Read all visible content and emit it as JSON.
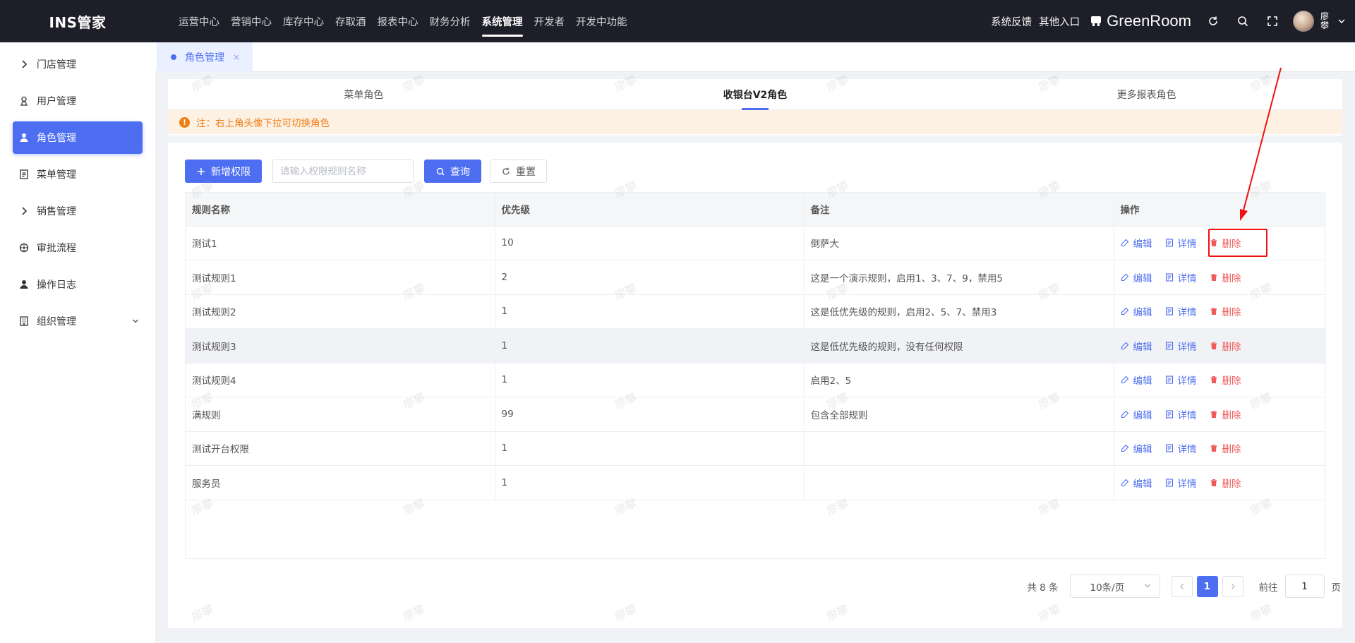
{
  "app": {
    "logo": "INS管家"
  },
  "topnav": [
    {
      "label": "运营中心",
      "active": false
    },
    {
      "label": "营销中心",
      "active": false
    },
    {
      "label": "库存中心",
      "active": false
    },
    {
      "label": "存取酒",
      "active": false
    },
    {
      "label": "报表中心",
      "active": false
    },
    {
      "label": "财务分析",
      "active": false
    },
    {
      "label": "系统管理",
      "active": true
    },
    {
      "label": "开发者",
      "active": false
    },
    {
      "label": "开发中功能",
      "active": false
    }
  ],
  "topright": {
    "feedback": "系统反馈",
    "other_entry": "其他入口",
    "store_icon": "store-icon",
    "store_name": "GreenRoom",
    "refresh_icon": "refresh-icon",
    "search_icon": "search-icon",
    "fullscreen_icon": "fullscreen-icon",
    "user_name": "廖攀",
    "caret_icon": "chevron-down-icon"
  },
  "sidebar": {
    "items": [
      {
        "label": "门店管理",
        "icon": "chevron-right-icon",
        "active": false
      },
      {
        "label": "用户管理",
        "icon": "user-icon",
        "active": false
      },
      {
        "label": "角色管理",
        "icon": "person-icon",
        "active": true
      },
      {
        "label": "菜单管理",
        "icon": "document-icon",
        "active": false
      },
      {
        "label": "销售管理",
        "icon": "chevron-right-icon",
        "active": false
      },
      {
        "label": "审批流程",
        "icon": "flow-icon",
        "active": false
      },
      {
        "label": "操作日志",
        "icon": "person-icon",
        "active": false
      },
      {
        "label": "组织管理",
        "icon": "building-icon",
        "active": false,
        "expandable": true
      }
    ]
  },
  "page_tabs": [
    {
      "label": "角色管理",
      "close": "×"
    }
  ],
  "role_tabs": [
    {
      "label": "菜单角色",
      "active": false
    },
    {
      "label": "收银台V2角色",
      "active": true
    },
    {
      "label": "更多报表角色",
      "active": false
    }
  ],
  "notice": {
    "icon": "warning-icon",
    "text": "注：右上角头像下拉可切换角色"
  },
  "toolbar": {
    "add_label": "新增权限",
    "search_placeholder": "请输入权限规则名称",
    "search_value": "",
    "query_label": "查询",
    "reset_label": "重置"
  },
  "table": {
    "headers": [
      "规则名称",
      "优先级",
      "备注",
      "操作"
    ],
    "actions": {
      "edit": "编辑",
      "detail": "详情",
      "delete": "删除"
    },
    "rows": [
      {
        "name": "测试1",
        "priority": "10",
        "note": "倒萨大"
      },
      {
        "name": "测试规则1",
        "priority": "2",
        "note": "这是一个演示规则，启用1、3、7、9，禁用5"
      },
      {
        "name": "测试规则2",
        "priority": "1",
        "note": "这是低优先级的规则，启用2、5、7、禁用3"
      },
      {
        "name": "测试规则3",
        "priority": "1",
        "note": "这是低优先级的规则，没有任何权限"
      },
      {
        "name": "测试规则4",
        "priority": "1",
        "note": "启用2、5"
      },
      {
        "name": "满规则",
        "priority": "99",
        "note": "包含全部规则"
      },
      {
        "name": "测试开台权限",
        "priority": "1",
        "note": ""
      },
      {
        "name": "服务员",
        "priority": "1",
        "note": ""
      }
    ]
  },
  "pagination": {
    "total": "共 8 条",
    "page_size": "10条/页",
    "current_page": "1",
    "goto_label": "前往",
    "goto_value": "1",
    "page_suffix": "页"
  },
  "watermark": "廖攀",
  "colors": {
    "primary": "#4e6ef2",
    "danger": "#f05a5a",
    "warning": "#f07d13",
    "topbar": "#1d1e27",
    "annotation": "#f01010"
  }
}
